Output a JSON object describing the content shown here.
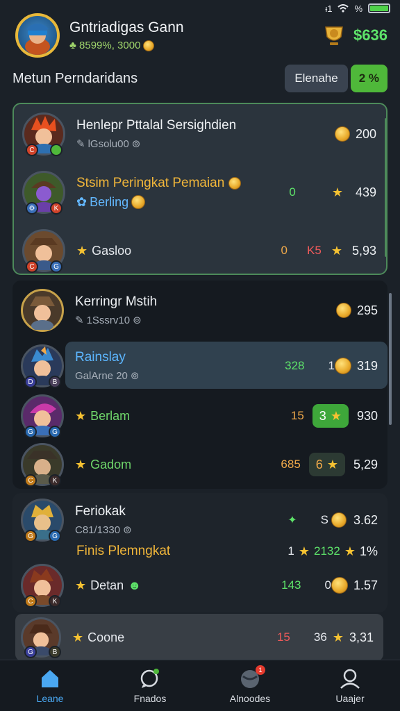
{
  "status_bar": {
    "signal_text": "ᵻ1",
    "battery_text": "%"
  },
  "header": {
    "title": "Gntriadigas Gann",
    "subtitle": "♣ 8599%, 3000",
    "score": "$636"
  },
  "section": {
    "title": "Metun Perndaridans",
    "filter_label": "Elenahe",
    "filter_value": "2 %"
  },
  "group1": {
    "rows": [
      {
        "name": "Henlepr Pttalal Sersighdien",
        "sub": "lGsolu00",
        "score": "200"
      },
      {
        "name": "Stsim Peringkat Pemaian",
        "sub": "Berling",
        "mid": "0",
        "score": "439"
      },
      {
        "name": "Gasloo",
        "mid": "0",
        "mid2": "K5",
        "score": "5,93"
      }
    ]
  },
  "group2": {
    "rows": [
      {
        "name": "Kerringr Mstih",
        "sub": "1Sssrv10",
        "score": "295"
      },
      {
        "name": "Rainslay",
        "sub": "GalArne 20",
        "mid": "328",
        "mid2": "1",
        "score": "319"
      },
      {
        "name": "Berlam",
        "mid": "15",
        "pill": "3",
        "score": "930"
      },
      {
        "name": "Gadom",
        "mid": "685",
        "pill": "6",
        "score": "5,29"
      }
    ]
  },
  "group3": {
    "rows": [
      {
        "name": "Feriokak",
        "sub": "C81/1330",
        "mid": "S",
        "score": "3.62"
      },
      {
        "caption": "Finis Plemngkat",
        "mid": "1",
        "mid2": "2132",
        "score": "1%"
      },
      {
        "name": "Detan",
        "mid": "143",
        "mid2": "0",
        "score": "1.57"
      }
    ]
  },
  "group4": {
    "row": {
      "name": "Coone",
      "mid": "15",
      "mid2": "36",
      "score": "3,31"
    }
  },
  "nav": {
    "items": [
      {
        "label": "Leane"
      },
      {
        "label": "Fnados"
      },
      {
        "label": "Alnoodes",
        "badge": "1"
      },
      {
        "label": "Uaajer"
      }
    ]
  },
  "colors": {
    "accent_green": "#5ee36a",
    "accent_orange": "#f0a94a",
    "nav_active": "#4aa8f2"
  }
}
